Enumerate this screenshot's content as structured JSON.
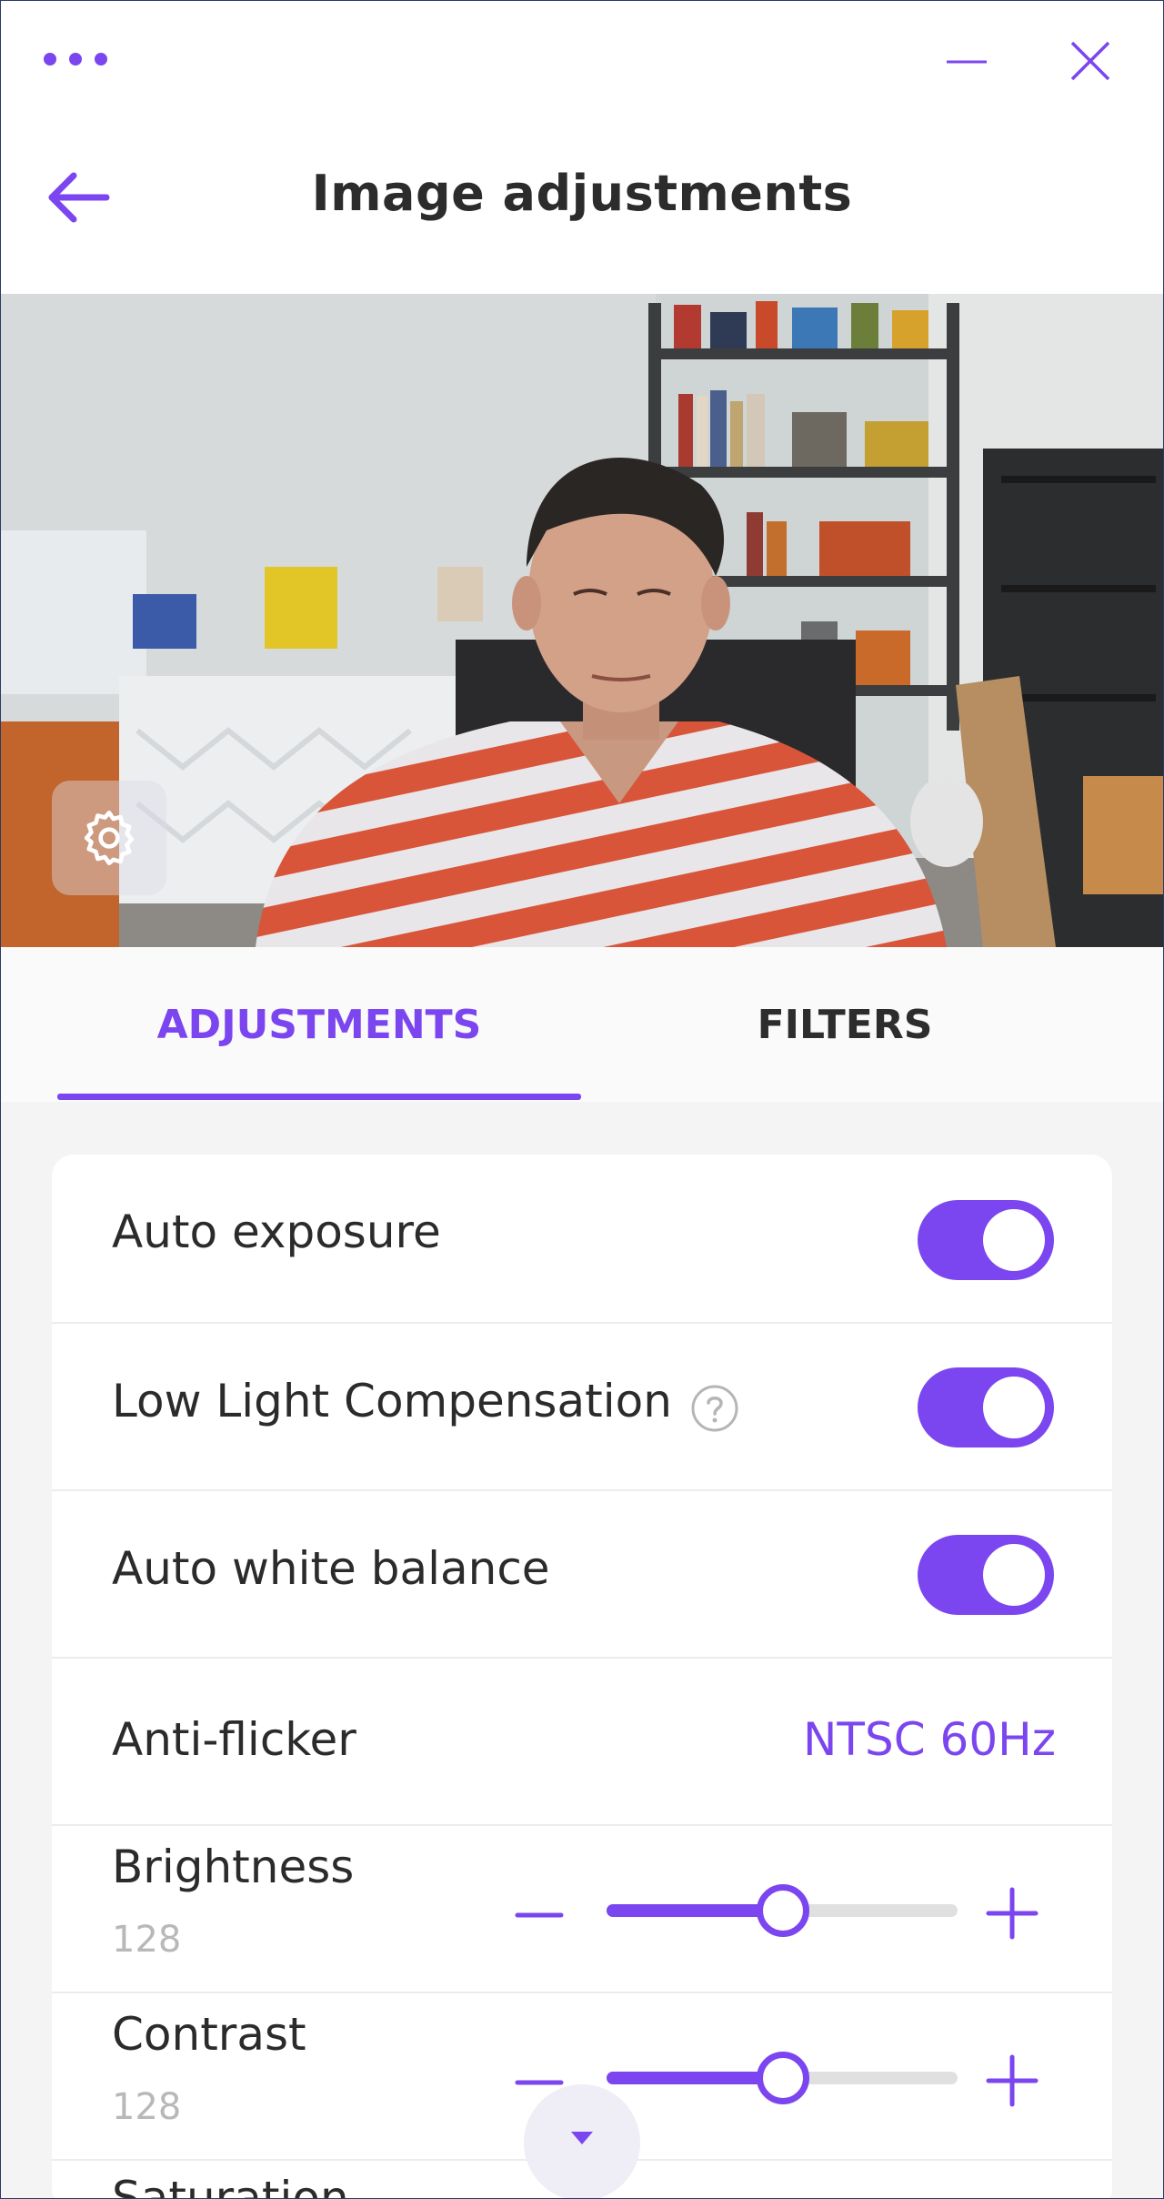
{
  "window": {
    "title": "Image adjustments",
    "more_icon": "more-dots-icon",
    "minimize_icon": "minimize-icon",
    "close_icon": "close-icon",
    "back_icon": "arrow-left-icon"
  },
  "preview": {
    "settings_icon": "gear-icon"
  },
  "tabs": [
    {
      "label": "ADJUSTMENTS",
      "active": true
    },
    {
      "label": "FILTERS",
      "active": false
    }
  ],
  "settings": {
    "auto_exposure": {
      "label": "Auto exposure",
      "on": true
    },
    "low_light": {
      "label": "Low Light Compensation",
      "on": true,
      "help_icon": "help-circle-icon"
    },
    "auto_white_balance": {
      "label": "Auto white balance",
      "on": true
    },
    "anti_flicker": {
      "label": "Anti-flicker",
      "value": "NTSC 60Hz"
    },
    "brightness": {
      "label": "Brightness",
      "value": "128",
      "min": 0,
      "max": 255
    },
    "contrast": {
      "label": "Contrast",
      "value": "128",
      "min": 0,
      "max": 255
    },
    "next_partial_label": "Saturation"
  },
  "scroll_icon": "caret-down-icon",
  "colors": {
    "accent": "#7b46ef",
    "text": "#2b2b2b",
    "muted": "#b8b8b8"
  }
}
